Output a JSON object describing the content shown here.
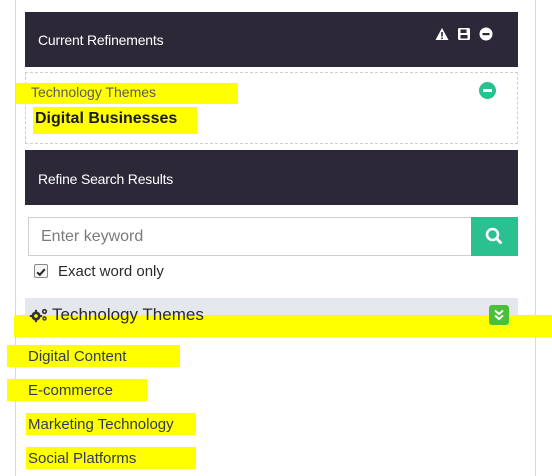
{
  "current_refinements": {
    "title": "Current Refinements",
    "icons": [
      "warning-icon",
      "save-icon",
      "minus-circle-icon"
    ],
    "item": {
      "category": "Technology Themes",
      "value": "Digital Businesses"
    }
  },
  "refine_search": {
    "title": "Refine Search Results",
    "keyword_placeholder": "Enter keyword",
    "keyword_value": "",
    "exact_word_label": "Exact word only",
    "exact_word_checked": true
  },
  "facet": {
    "title": "Technology Themes",
    "icon": "cogs-icon",
    "options": [
      "Digital Content",
      "E-commerce",
      "Marketing Technology",
      "Social Platforms"
    ]
  },
  "colors": {
    "header_bg": "#2d2838",
    "accent_green": "#2bc08f",
    "toggle_green": "#4cbf3a",
    "highlight": "#ffff00"
  }
}
